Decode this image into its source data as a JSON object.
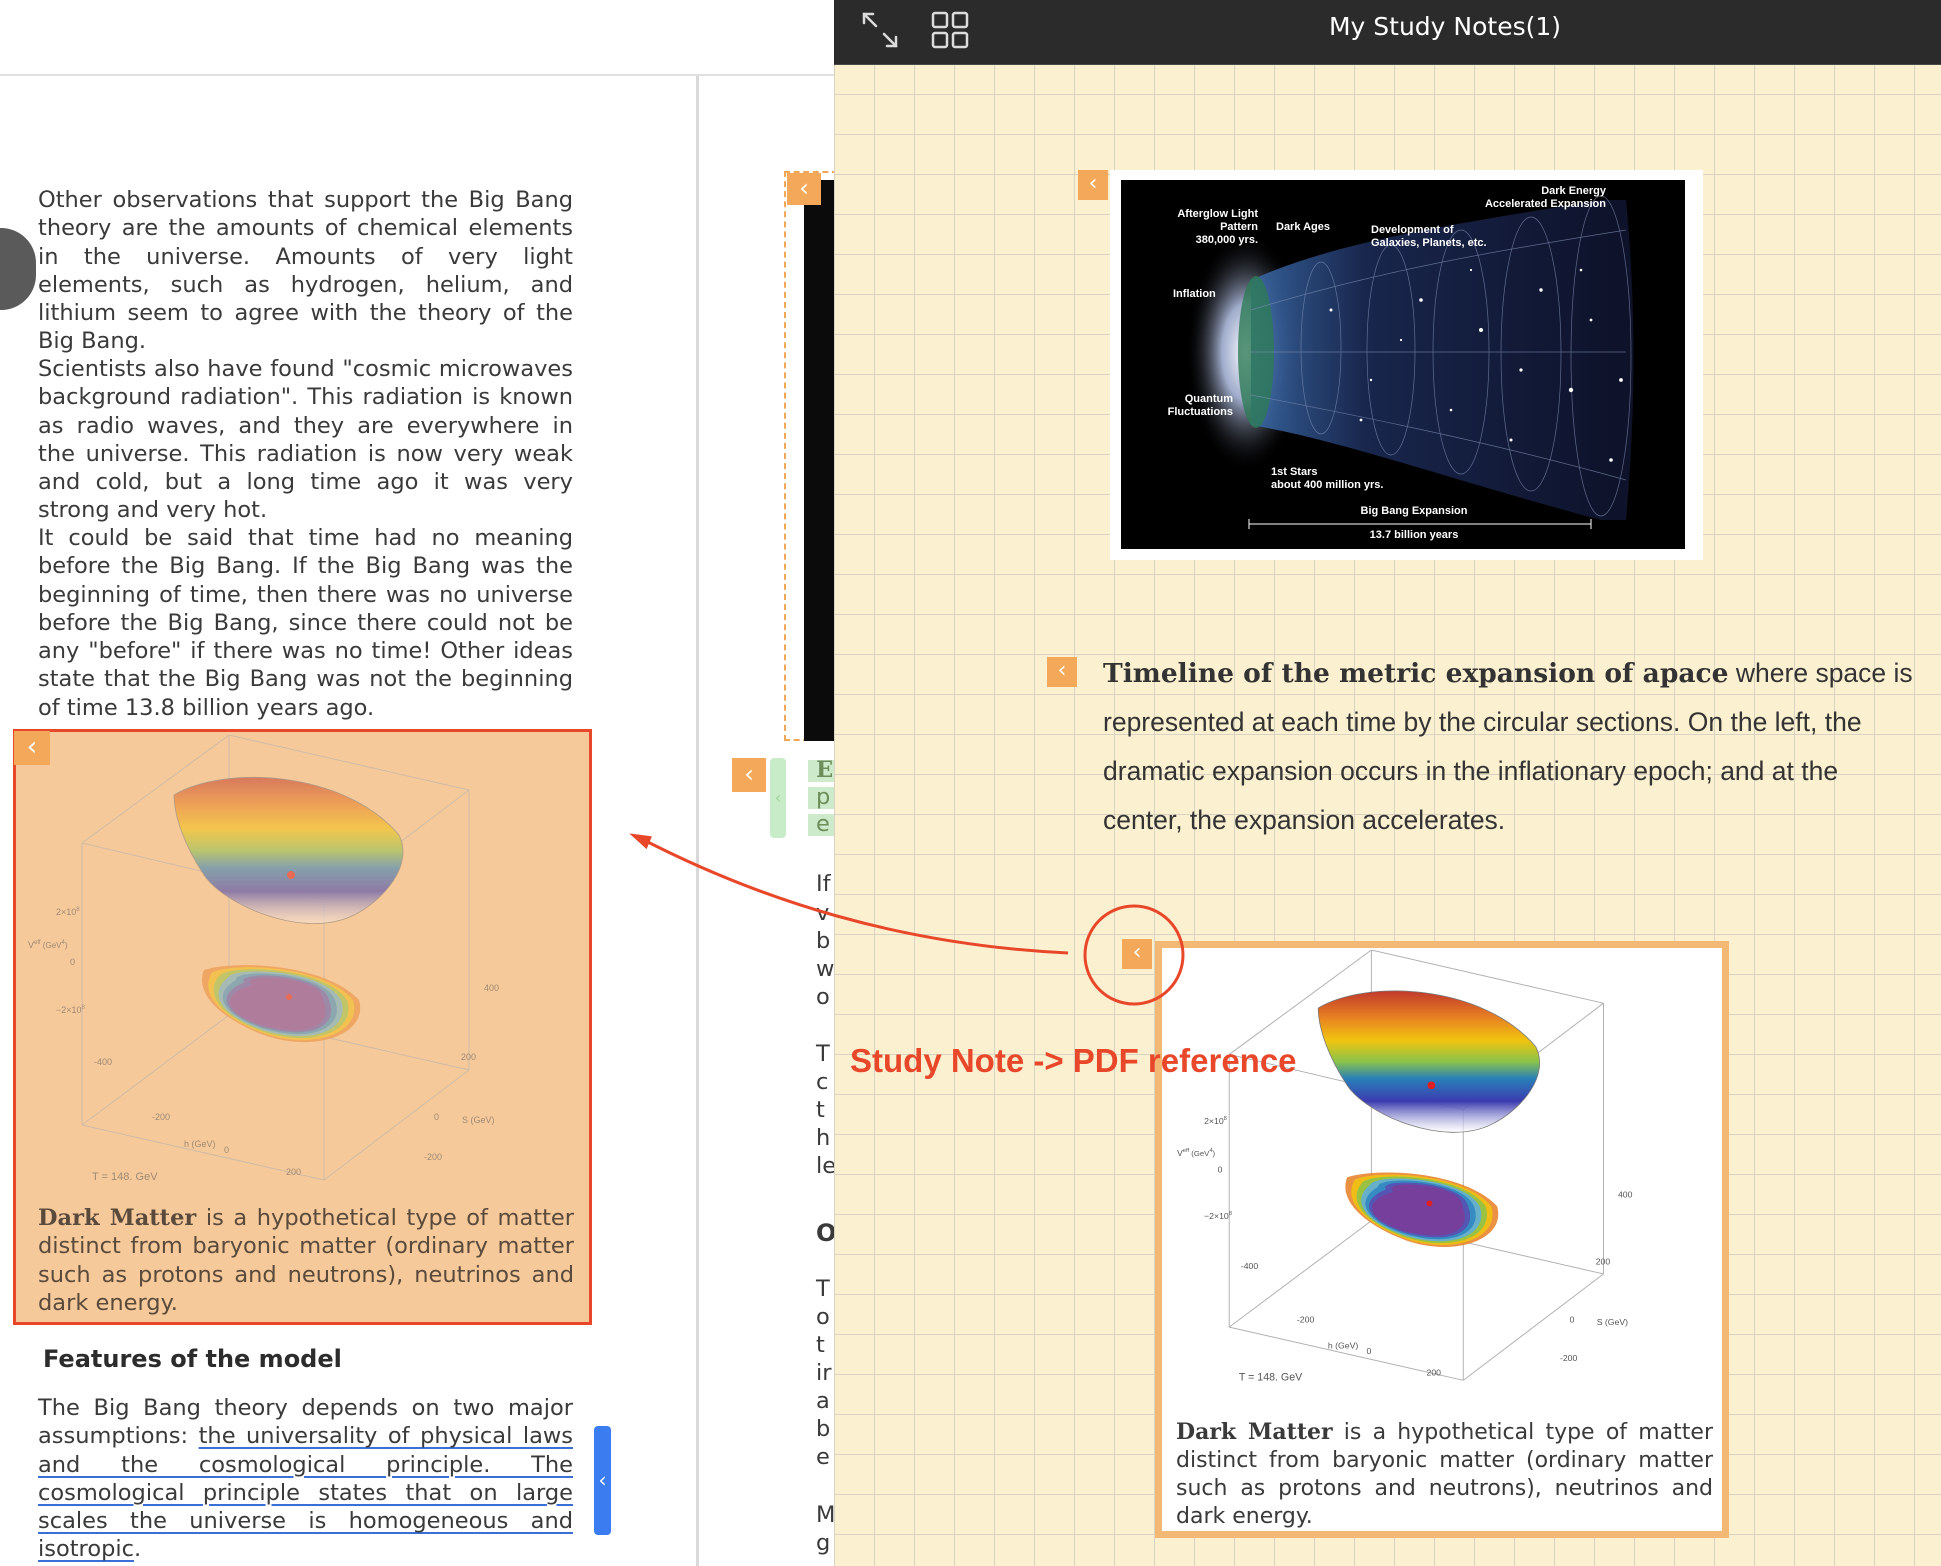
{
  "pdf": {
    "paragraphs": [
      "Other observations that support the Big Bang theory are the amounts of chemical elements in the universe. Amounts of very light elements, such as hydrogen, helium, and lithium seem to agree with the theory of the Big Bang.",
      "Scientists also have found \"cosmic microwaves background radiation\". This radiation is known as radio waves, and they are everywhere in the universe. This radiation is now very weak and cold, but a long time ago it was very strong and very hot.",
      "It could be said that time had no meaning before the Big Bang. If the Big Bang was the beginning of time, then there was no universe before the Big Bang, since there could not be any \"before\" if there was no time! Other ideas state that the Big Bang was not the beginning of time 13.8 billion years ago."
    ],
    "dark_matter": {
      "term": "Dark Matter",
      "caption": " is a hypothetical type of matter distinct from baryonic matter (ordinary matter such as protons and neutrons), neutrinos and dark energy."
    },
    "features_heading": "Features of the model",
    "features_para": {
      "lead": "The Big Bang theory depends on two major assumptions: ",
      "underlined": "the universality of physical laws and the cosmological principle. The cosmological principle states that on large scales the universe is homogeneous and isotropic",
      "tail": "."
    },
    "middle_column_letters": [
      "E",
      "p",
      "e",
      "If",
      "v",
      "b",
      "w",
      "o",
      "T",
      "c",
      "t",
      "h",
      "le",
      "O",
      "T",
      "o",
      "t",
      "ir",
      "a",
      "b",
      "e",
      "M",
      "g"
    ]
  },
  "plot": {
    "label_vaxis": "V",
    "label_vsup": "eff",
    "label_vunit": " (GeV",
    "label_vunit_sup": "4",
    "label_vclose": ")",
    "tick_pos_base": "2×10",
    "tick_neg_base": "−2×10",
    "tick_exp": "8",
    "temperature": "T = 148.  GeV",
    "h_axis": "h (GeV)",
    "s_axis": "S (GeV)",
    "h_ticks": [
      "-400",
      "-200",
      "0",
      "200",
      "400"
    ],
    "s_ticks": [
      "400",
      "200",
      "0",
      "-200",
      "-400"
    ],
    "zero": "0"
  },
  "notes": {
    "title": "My Study Notes(1)",
    "timeline_bold": "Timeline of the metric expansion of apace",
    "timeline_rest": " where space is represented at each time by the circular sections. On the left, the dramatic expansion occurs in the inflationary epoch; and at the center, the expansion accelerates.",
    "annotation": "Study Note -> PDF reference"
  },
  "bigbang_image": {
    "labels": {
      "afterglow": "Afterglow Light",
      "pattern": "Pattern",
      "years380": "380,000 yrs.",
      "dark_ages": "Dark Ages",
      "development": "Development of",
      "galaxies": "Galaxies, Planets, etc.",
      "dark_energy": "Dark Energy",
      "accelerated": "Accelerated Expansion",
      "inflation": "Inflation",
      "quantum": "Quantum",
      "fluctuations": "Fluctuations",
      "first_stars": "1st Stars",
      "about400": "about 400 million yrs.",
      "bb_expansion": "Big Bang Expansion",
      "billion": "13.7 billion years"
    }
  },
  "icons": {
    "collapse": "‹",
    "expand": "expand-icon",
    "grid": "grid-icon"
  },
  "colors": {
    "annotation_red": "#e8472a",
    "note_orange": "#f3a85a",
    "notes_bg": "#fbf1d0",
    "link_blue": "#3b7cf0"
  }
}
